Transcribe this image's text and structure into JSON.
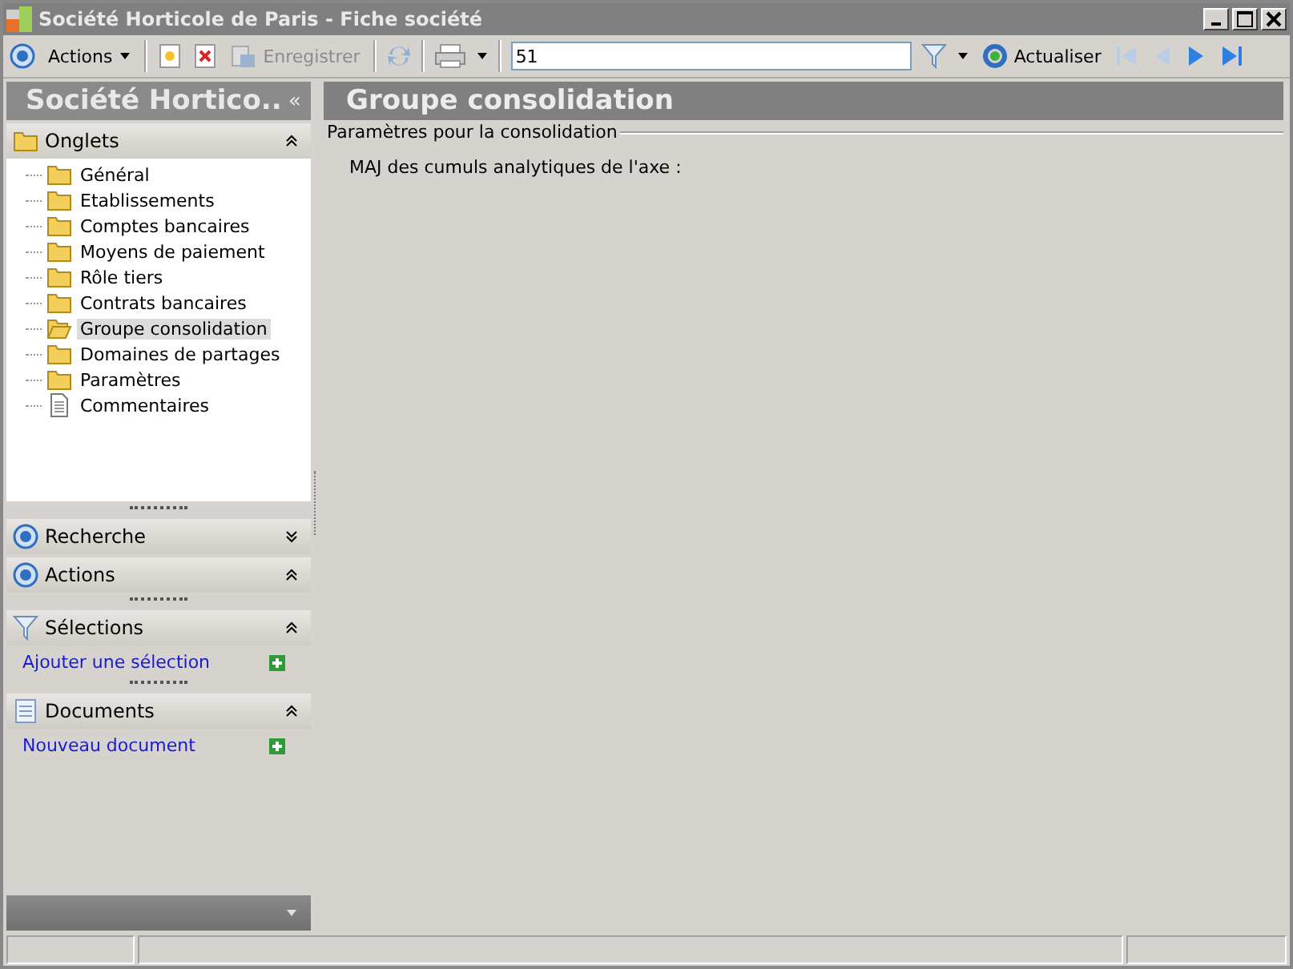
{
  "window": {
    "title": "Société Horticole de Paris -  Fiche société"
  },
  "toolbar": {
    "actions_label": "Actions",
    "save_label": "Enregistrer",
    "save_disabled": true,
    "search_value": "51",
    "refresh_label": "Actualiser"
  },
  "sidebar": {
    "title": "Société Hortico..",
    "collapse_glyph": "«",
    "tabs_header": "Onglets",
    "tabs": [
      {
        "label": "Général",
        "kind": "folder",
        "selected": false
      },
      {
        "label": "Etablissements",
        "kind": "folder",
        "selected": false
      },
      {
        "label": "Comptes bancaires",
        "kind": "folder",
        "selected": false
      },
      {
        "label": "Moyens de paiement",
        "kind": "folder",
        "selected": false
      },
      {
        "label": "Rôle tiers",
        "kind": "folder",
        "selected": false
      },
      {
        "label": "Contrats bancaires",
        "kind": "folder",
        "selected": false
      },
      {
        "label": "Groupe consolidation",
        "kind": "folder",
        "selected": true
      },
      {
        "label": "Domaines de partages",
        "kind": "folder",
        "selected": false
      },
      {
        "label": "Paramètres",
        "kind": "folder",
        "selected": false
      },
      {
        "label": "Commentaires",
        "kind": "document",
        "selected": false
      }
    ],
    "sections": [
      {
        "title": "Recherche",
        "kind": "target",
        "expanded": false
      },
      {
        "title": "Actions",
        "kind": "target",
        "expanded": true
      },
      {
        "title": "Sélections",
        "kind": "filter",
        "expanded": true,
        "link": "Ajouter une sélection"
      },
      {
        "title": "Documents",
        "kind": "document",
        "expanded": true,
        "link": "Nouveau document"
      }
    ]
  },
  "content": {
    "title": "Groupe consolidation",
    "group_label": "Paramètres pour la consolidation",
    "field_label": "MAJ des cumuls analytiques de l'axe :"
  }
}
